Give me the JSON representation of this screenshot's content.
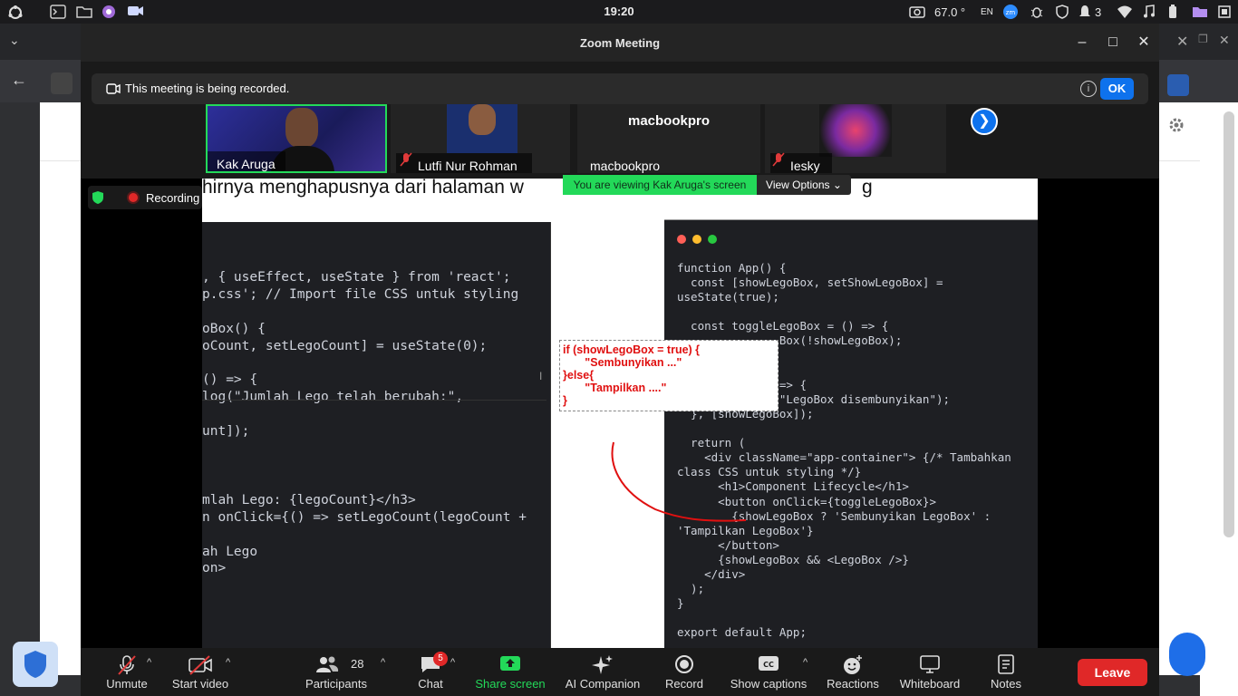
{
  "system_bar": {
    "clock": "19:20",
    "temperature": "67.0 °",
    "keyboard_layout": "EN",
    "notification_count": "3"
  },
  "window": {
    "title": "Zoom Meeting"
  },
  "recording_banner": {
    "text": "This meeting is being recorded.",
    "ok_label": "OK"
  },
  "participants_strip": [
    {
      "name": "Kak Aruga",
      "muted": false
    },
    {
      "name": "Lutfi Nur Rohman",
      "muted": true
    },
    {
      "name": "macbookpro",
      "muted": false,
      "display_text": "macbookpro"
    },
    {
      "name": "Iesky",
      "muted": true
    }
  ],
  "share": {
    "viewing_label": "You are viewing Kak Aruga's screen",
    "view_options_label": "View Options",
    "recording_label": "Recording",
    "slide_heading": "hirnya menghapusnya dari halaman w",
    "slide_heading_tail": "g",
    "left_code": [
      ", { useEffect, useState } from 'react';",
      "p.css'; // Import file CSS untuk styling",
      "",
      "oBox() {",
      "oCount, setLegoCount] = useState(0);",
      "",
      "() => {",
      "log(\"Jumlah Lego telah berubah:\",",
      "",
      "unt]);",
      "",
      "",
      "",
      "mlah Lego: {legoCount}</h3>",
      "n onClick={() => setLegoCount(legoCount +",
      "",
      "ah Lego",
      "on>"
    ],
    "right_code": [
      "function App() {",
      "  const [showLegoBox, setShowLegoBox] =",
      "useState(true);",
      "",
      "  const toggleLegoBox = () => {",
      "               Box(!showLegoBox);",
      "",
      "",
      "               => {",
      "               \"LegoBox disembunyikan\");",
      "  }, [showLegoBox]);",
      "",
      "  return (",
      "    <div className=\"app-container\"> {/* Tambahkan",
      "class CSS untuk styling */}",
      "      <h1>Component Lifecycle</h1>",
      "      <button onClick={toggleLegoBox}>",
      "        {showLegoBox ? 'Sembunyikan LegoBox' :",
      "'Tampilkan LegoBox'}",
      "      </button>",
      "      {showLegoBox && <LegoBox />}",
      "    </div>",
      "  );",
      "}",
      "",
      "export default App;"
    ],
    "annotation_lines": [
      "if (showLegoBox = true) {",
      "       \"Sembunyikan ...\"",
      "}else{",
      "       \"Tampilkan ....\"",
      "}"
    ]
  },
  "toolbar": {
    "unmute": "Unmute",
    "start_video": "Start video",
    "participants_count": "28",
    "participants": "Participants",
    "chat": "Chat",
    "chat_badge": "5",
    "share_screen": "Share screen",
    "ai_companion": "AI Companion",
    "record": "Record",
    "show_captions": "Show captions",
    "reactions": "Reactions",
    "whiteboard": "Whiteboard",
    "notes": "Notes",
    "leave": "Leave"
  },
  "colors": {
    "zoom_blue": "#0e72ed",
    "share_green": "#23d959",
    "leave_red": "#e02828",
    "annotation_red": "#e01010"
  }
}
